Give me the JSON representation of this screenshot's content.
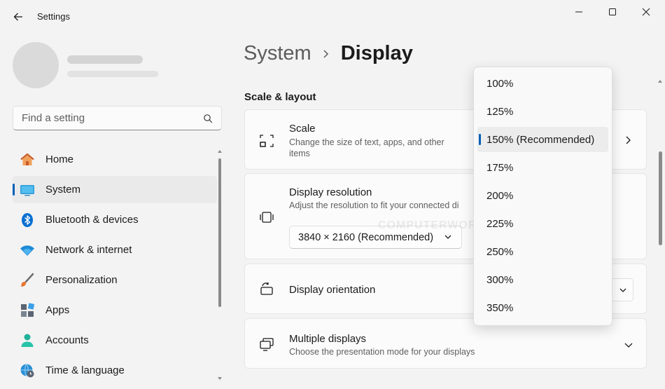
{
  "window": {
    "title": "Settings"
  },
  "search": {
    "placeholder": "Find a setting"
  },
  "sidebar": {
    "items": [
      {
        "label": "Home",
        "icon": "home-icon"
      },
      {
        "label": "System",
        "icon": "system-icon"
      },
      {
        "label": "Bluetooth & devices",
        "icon": "bluetooth-icon"
      },
      {
        "label": "Network & internet",
        "icon": "wifi-icon"
      },
      {
        "label": "Personalization",
        "icon": "brush-icon"
      },
      {
        "label": "Apps",
        "icon": "apps-icon"
      },
      {
        "label": "Accounts",
        "icon": "accounts-icon"
      },
      {
        "label": "Time & language",
        "icon": "globe-clock-icon"
      }
    ],
    "selected": "System"
  },
  "breadcrumb": {
    "parent": "System",
    "current": "Display"
  },
  "section": {
    "title": "Scale & layout"
  },
  "cards": {
    "scale": {
      "title": "Scale",
      "desc_line1": "Change the size of text, apps, and other",
      "desc_line2": "items"
    },
    "resolution": {
      "title": "Display resolution",
      "desc": "Adjust the resolution to fit your connected di",
      "value": "3840 × 2160 (Recommended)"
    },
    "orientation": {
      "title": "Display orientation"
    },
    "multiple": {
      "title": "Multiple displays",
      "desc": "Choose the presentation mode for your displays"
    }
  },
  "watermark": "COMPUTERWORLD",
  "scale_dropdown": {
    "options": [
      "100%",
      "125%",
      "150% (Recommended)",
      "175%",
      "200%",
      "225%",
      "250%",
      "300%",
      "350%"
    ],
    "selected": "150% (Recommended)"
  },
  "colors": {
    "accent": "#005fb8",
    "background": "#f3f3f3",
    "card": "#fbfbfb"
  }
}
